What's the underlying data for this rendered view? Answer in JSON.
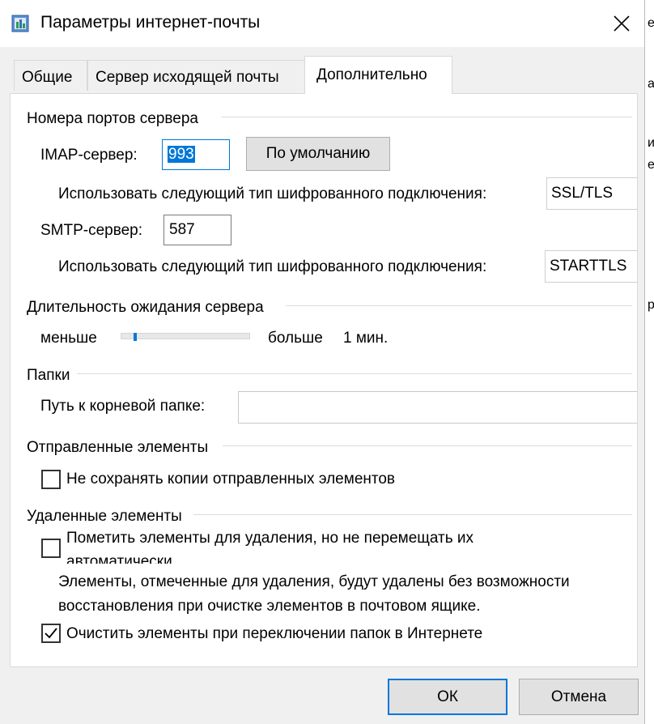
{
  "window": {
    "title": "Параметры интернет-почты"
  },
  "tabs": [
    {
      "label": "Общие"
    },
    {
      "label": "Сервер исходящей почты"
    },
    {
      "label": "Дополнительно"
    }
  ],
  "server_ports": {
    "group_title": "Номера портов сервера",
    "imap_label": "IMAP-сервер:",
    "imap_value": "993",
    "default_button": "По умолчанию",
    "imap_enc_label": "Использовать следующий тип шифрованного подключения:",
    "imap_enc_value": "SSL/TLS",
    "smtp_label": "SMTP-сервер:",
    "smtp_value": "587",
    "smtp_enc_label": "Использовать следующий тип шифрованного подключения:",
    "smtp_enc_value": "STARTTLS"
  },
  "timeout": {
    "group_title": "Длительность ожидания сервера",
    "less_label": "меньше",
    "more_label": "больше",
    "value_label": "1 мин.",
    "slider_level": 0.1
  },
  "folders": {
    "group_title": "Папки",
    "root_label": "Путь к корневой папке:",
    "root_value": ""
  },
  "sent_items": {
    "group_title": "Отправленные элементы",
    "no_copies_label": "Не сохранять копии отправленных элементов",
    "no_copies_checked": false
  },
  "deleted_items": {
    "group_title": "Удаленные элементы",
    "mark_label_line1": "Пометить элементы для удаления, но не перемещать их",
    "mark_label_line2": "автоматически",
    "mark_checked": false,
    "info_line1": "Элементы, отмеченные для удаления, будут удалены без возможности",
    "info_line2": "восстановления при очистке элементов в почтовом ящике.",
    "purge_label": "Очистить элементы при переключении папок в Интернете",
    "purge_checked": true
  },
  "buttons": {
    "ok": "ОК",
    "cancel": "Отмена"
  },
  "right_edge_chars": [
    "е",
    "а",
    "и",
    "е",
    "р"
  ],
  "colors": {
    "accent": "#0078d7",
    "dialog_bg": "#f0f0f0"
  }
}
